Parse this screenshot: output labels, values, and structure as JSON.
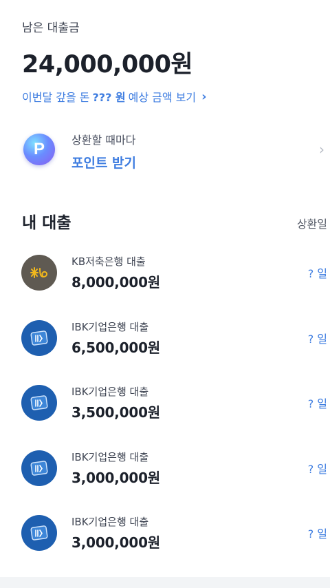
{
  "summary": {
    "label": "남은 대출금",
    "amount": "24,000,000원",
    "link_prefix": "이번달 갚을 돈",
    "link_bold": "??? 원",
    "link_suffix": "예상 금액 보기",
    "chevron": "›"
  },
  "points": {
    "badge_letter": "P",
    "subtitle": "상환할 때마다",
    "title": "포인트 받기",
    "chevron": "›"
  },
  "loans": {
    "title": "내 대출",
    "column_label": "상환일",
    "items": [
      {
        "logo": "kb-star-logo-icon",
        "name": "KB저축은행 대출",
        "amount": "8,000,000원",
        "day": "? 일"
      },
      {
        "logo": "ibk-logo-icon",
        "name": "IBK기업은행 대출",
        "amount": "6,500,000원",
        "day": "? 일"
      },
      {
        "logo": "ibk-logo-icon",
        "name": "IBK기업은행 대출",
        "amount": "3,500,000원",
        "day": "? 일"
      },
      {
        "logo": "ibk-logo-icon",
        "name": "IBK기업은행 대출",
        "amount": "3,000,000원",
        "day": "? 일"
      },
      {
        "logo": "ibk-logo-icon",
        "name": "IBK기업은행 대출",
        "amount": "3,000,000원",
        "day": "? 일"
      }
    ]
  },
  "colors": {
    "accent": "#3d7ce0",
    "ibk_blue": "#1e5fb0",
    "kb_brown": "#5f5a52"
  }
}
